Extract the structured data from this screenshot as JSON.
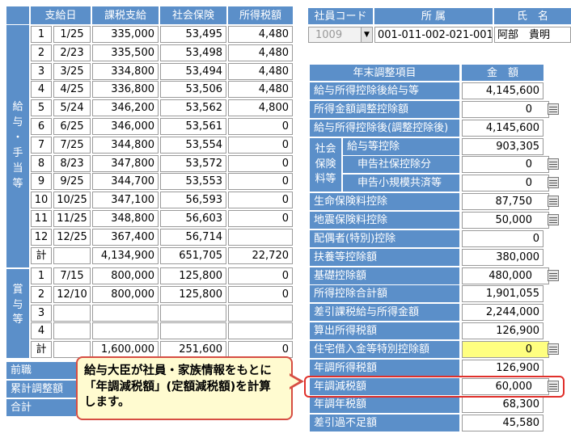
{
  "salary_table": {
    "headers": [
      "支給日",
      "課税支給",
      "社会保険",
      "所得税額"
    ],
    "side_label": [
      "給",
      "与",
      "・",
      "手",
      "当",
      "等"
    ],
    "rows": [
      {
        "no": "1",
        "date": "1/25",
        "taxable": "335,000",
        "social": "53,495",
        "tax": "4,480"
      },
      {
        "no": "2",
        "date": "2/23",
        "taxable": "335,500",
        "social": "53,498",
        "tax": "4,480"
      },
      {
        "no": "3",
        "date": "3/25",
        "taxable": "334,800",
        "social": "53,494",
        "tax": "4,480"
      },
      {
        "no": "4",
        "date": "4/25",
        "taxable": "336,800",
        "social": "53,506",
        "tax": "4,480"
      },
      {
        "no": "5",
        "date": "5/24",
        "taxable": "346,200",
        "social": "53,562",
        "tax": "4,800"
      },
      {
        "no": "6",
        "date": "6/25",
        "taxable": "346,000",
        "social": "53,561",
        "tax": "0"
      },
      {
        "no": "7",
        "date": "7/25",
        "taxable": "344,800",
        "social": "53,554",
        "tax": "0"
      },
      {
        "no": "8",
        "date": "8/23",
        "taxable": "347,800",
        "social": "53,572",
        "tax": "0"
      },
      {
        "no": "9",
        "date": "9/25",
        "taxable": "344,700",
        "social": "53,553",
        "tax": "0"
      },
      {
        "no": "10",
        "date": "10/25",
        "taxable": "347,100",
        "social": "56,593",
        "tax": "0"
      },
      {
        "no": "11",
        "date": "11/25",
        "taxable": "348,800",
        "social": "56,603",
        "tax": "0"
      },
      {
        "no": "12",
        "date": "12/25",
        "taxable": "367,400",
        "social": "56,714",
        "tax": ""
      }
    ],
    "total": {
      "label": "計",
      "taxable": "4,134,900",
      "social": "651,705",
      "tax": "22,720"
    }
  },
  "bonus_table": {
    "side_label": [
      "賞",
      "与",
      "等"
    ],
    "rows": [
      {
        "no": "1",
        "date": "7/15",
        "taxable": "800,000",
        "social": "125,800",
        "tax": "0"
      },
      {
        "no": "2",
        "date": "12/10",
        "taxable": "800,000",
        "social": "125,800",
        "tax": "0"
      },
      {
        "no": "3",
        "date": "",
        "taxable": "",
        "social": "",
        "tax": ""
      },
      {
        "no": "4",
        "date": "",
        "taxable": "",
        "social": "",
        "tax": ""
      }
    ],
    "total": {
      "label": "計",
      "taxable": "1,600,000",
      "social": "251,600",
      "tax": "0"
    }
  },
  "bottom_rows": [
    "前職",
    "累計調整額",
    "合計"
  ],
  "employee": {
    "code_label": "社員コード",
    "dept_label": "所 属",
    "name_label": "氏　名",
    "code_value": "1009",
    "dept_value": "001-011-002-021-001",
    "name_value": "阿部　貴明"
  },
  "adjust_table": {
    "header_item": "年末調整項目",
    "header_amount": "金　額",
    "rows": [
      {
        "label": "給与所得控除後給与等",
        "value": "4,145,600",
        "calc": false
      },
      {
        "label": "所得金額調整控除額",
        "value": "0",
        "calc": true
      },
      {
        "label": "給与所得控除後(調整控除後)",
        "value": "4,145,600",
        "calc": false
      },
      {
        "label": "給与等控除",
        "value": "903,305",
        "calc": false
      },
      {
        "label": "申告社保控除分",
        "value": "0",
        "calc": true
      },
      {
        "label": "申告小規模共済等",
        "value": "0",
        "calc": true
      },
      {
        "label": "生命保険料控除",
        "value": "87,750",
        "calc": true
      },
      {
        "label": "地震保険料控除",
        "value": "50,000",
        "calc": true
      },
      {
        "label": "配偶者(特別)控除",
        "value": "0",
        "calc": false
      },
      {
        "label": "扶養等控除額",
        "value": "380,000",
        "calc": false
      },
      {
        "label": "基礎控除額",
        "value": "480,000",
        "calc": true
      },
      {
        "label": "所得控除合計額",
        "value": "1,901,055",
        "calc": false
      },
      {
        "label": "差引課税給与所得金額",
        "value": "2,244,000",
        "calc": false
      },
      {
        "label": "算出所得税額",
        "value": "126,900",
        "calc": false
      },
      {
        "label": "住宅借入金等特別控除額",
        "value": "0",
        "calc": true
      },
      {
        "label": "年調所得税額",
        "value": "126,900",
        "calc": false
      },
      {
        "label": "年調減税額",
        "value": "60,000",
        "calc": true
      },
      {
        "label": "年調年税額",
        "value": "68,300",
        "calc": false
      },
      {
        "label": "差引過不足額",
        "value": "45,580",
        "calc": false
      }
    ],
    "group_label": [
      "社会",
      "保険",
      "料等"
    ]
  },
  "callout": {
    "line1": "給与大臣が社員・家族情報をもとに",
    "line2": "「年調減税額」(定額減税額)を計算",
    "line3": "します。",
    "border_color": "#d64d43"
  },
  "colors": {
    "header_blue": "#5b8fc9",
    "highlight_red": "#e0302b",
    "input_yellow": "#ffff80"
  }
}
